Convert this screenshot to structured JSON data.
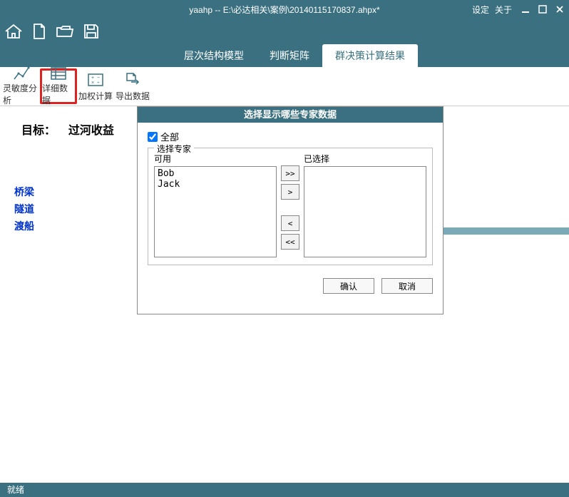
{
  "titlebar": {
    "title": "yaahp -- E:\\必达相关\\案例\\20140115170837.ahpx*",
    "settings": "设定",
    "about": "关于"
  },
  "tabs": {
    "hierarchy": "层次结构模型",
    "judgment": "判断矩阵",
    "group_result": "群决策计算结果"
  },
  "toolbar": {
    "sensitivity": "灵敏度分析",
    "detail": "详细数据",
    "weighted": "加权计算",
    "export": "导出数据"
  },
  "content": {
    "target_prefix": "目标：",
    "target_value": "过河收益",
    "links": {
      "bridge": "桥梁",
      "tunnel": "隧道",
      "ferry": "渡船"
    }
  },
  "dialog": {
    "title": "选择显示哪些专家数据",
    "all_label": "全部",
    "fieldset_legend": "选择专家",
    "available_label": "可用",
    "selected_label": "已选择",
    "available_items": [
      "Bob",
      "Jack"
    ],
    "btn_all_right": ">>",
    "btn_right": ">",
    "btn_left": "<",
    "btn_all_left": "<<",
    "ok": "确认",
    "cancel": "取消"
  },
  "statusbar": {
    "ready": "就绪"
  }
}
